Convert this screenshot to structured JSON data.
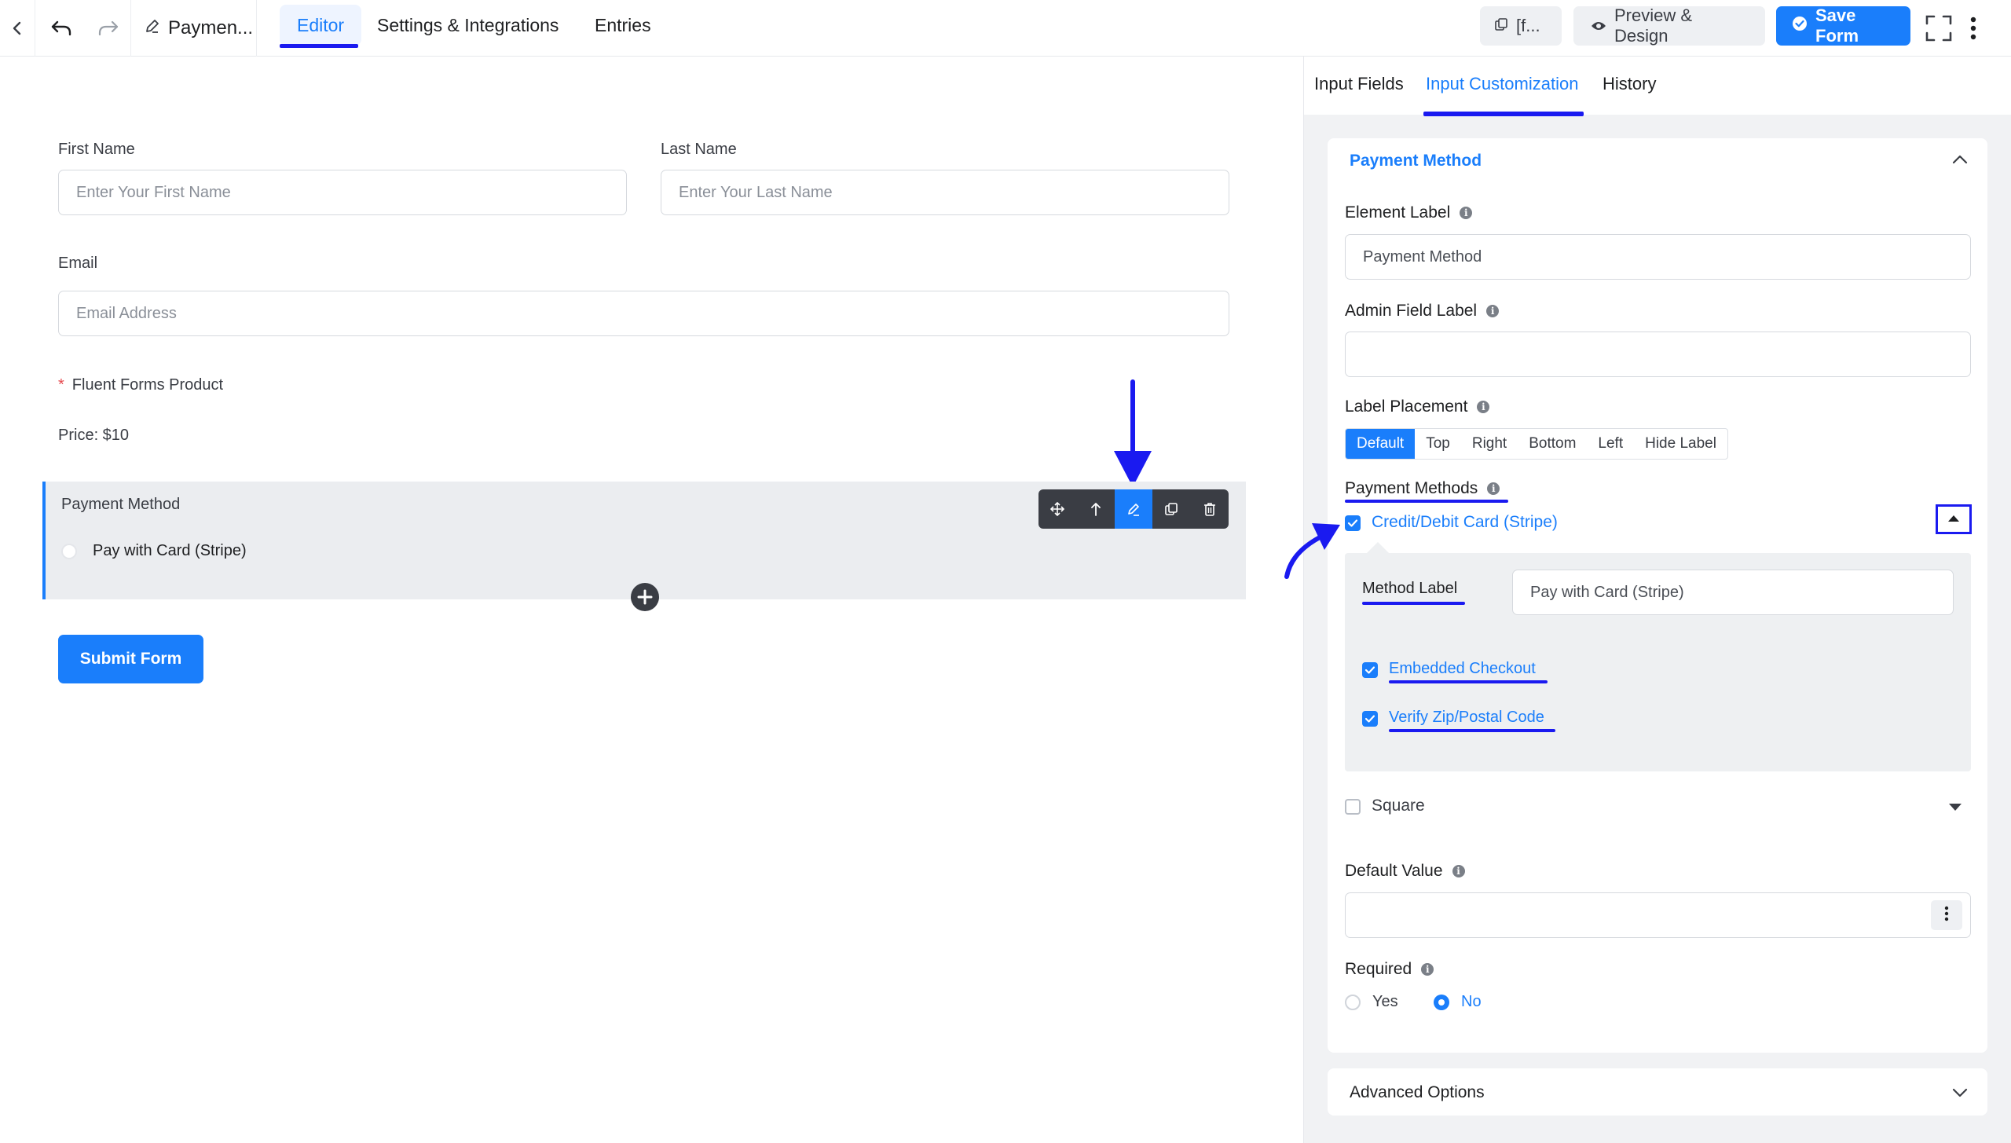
{
  "topbar": {
    "form_title": "Paymen...",
    "tabs": [
      "Editor",
      "Settings & Integrations",
      "Entries"
    ],
    "shortcode_label": "[f...",
    "preview_label": "Preview & Design",
    "save_label": "Save Form"
  },
  "form": {
    "first_name_label": "First Name",
    "first_name_placeholder": "Enter Your First Name",
    "last_name_label": "Last Name",
    "last_name_placeholder": "Enter Your Last Name",
    "email_label": "Email",
    "email_placeholder": "Email Address",
    "product_required": "*",
    "product_label": "Fluent Forms Product",
    "price_text": "Price: $10",
    "payment_block_label": "Payment Method",
    "payment_option": "Pay with Card (Stripe)",
    "submit_label": "Submit Form"
  },
  "panel": {
    "tabs": [
      "Input Fields",
      "Input Customization",
      "History"
    ],
    "section_title": "Payment Method",
    "element_label_title": "Element Label",
    "element_label_value": "Payment Method",
    "admin_label_title": "Admin Field Label",
    "admin_label_value": "",
    "placement_title": "Label Placement",
    "placement_options": [
      "Default",
      "Top",
      "Right",
      "Bottom",
      "Left",
      "Hide Label"
    ],
    "placement_selected": "Default",
    "methods_title": "Payment Methods",
    "stripe_label": "Credit/Debit Card (Stripe)",
    "method_label_title": "Method Label",
    "method_label_value": "Pay with Card (Stripe)",
    "embedded_checkout": "Embedded Checkout",
    "verify_zip": "Verify Zip/Postal Code",
    "square_label": "Square",
    "default_value_title": "Default Value",
    "default_value": "",
    "required_title": "Required",
    "required_yes": "Yes",
    "required_no": "No",
    "required_selected": "No",
    "advanced_options": "Advanced Options"
  },
  "colors": {
    "accent": "#1a7efb",
    "annotation": "#1a1af0"
  }
}
